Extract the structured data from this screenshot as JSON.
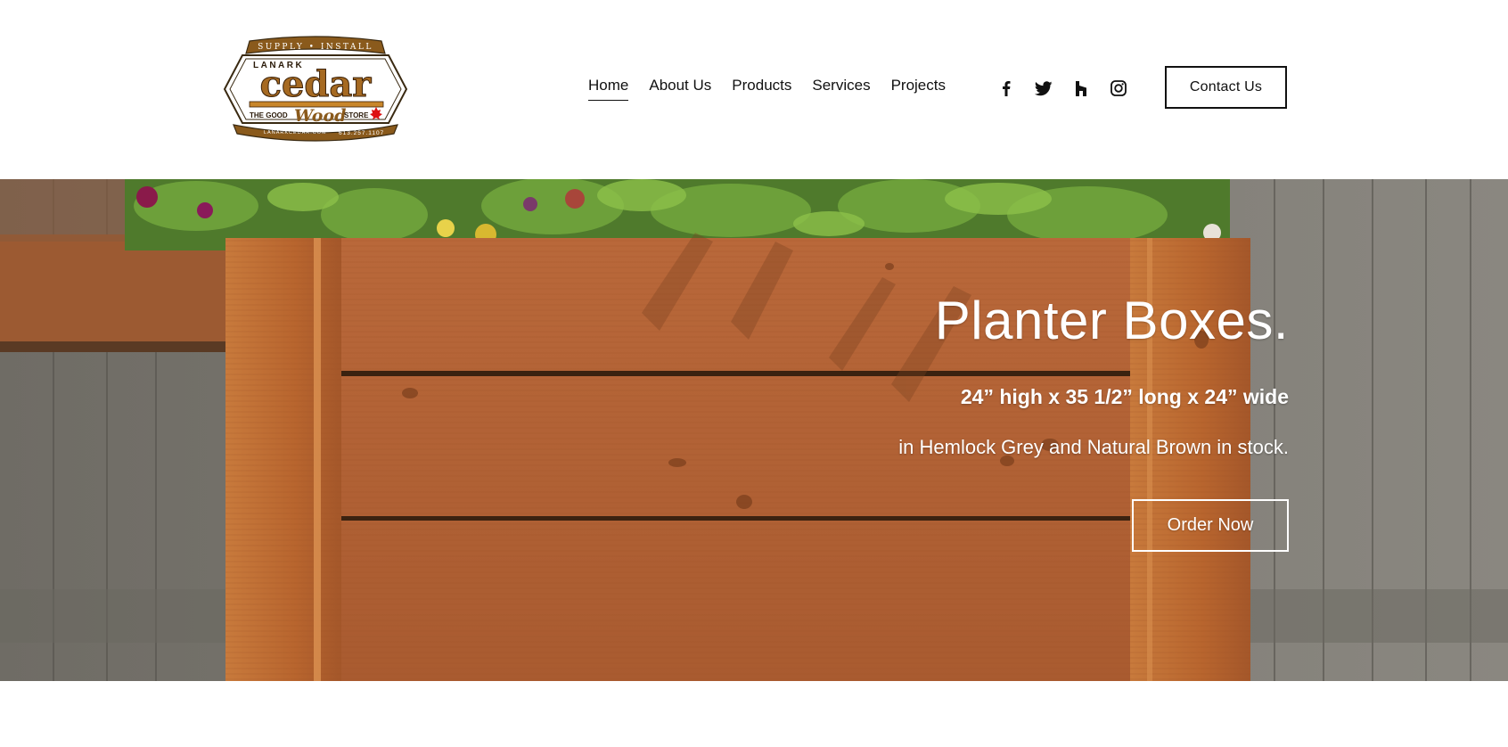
{
  "logo": {
    "top_text": "SUPPLY • INSTALL",
    "brand_small": "LANARK",
    "brand_main": "cedar",
    "tagline_left": "THE GOOD",
    "tagline_script": "Wood",
    "tagline_right": "STORE",
    "bottom_left": "LANARKCEDAR.COM",
    "bottom_right": "613.257.1107"
  },
  "nav": {
    "items": [
      {
        "label": "Home",
        "active": true
      },
      {
        "label": "About Us",
        "active": false
      },
      {
        "label": "Products",
        "active": false
      },
      {
        "label": "Services",
        "active": false
      },
      {
        "label": "Projects",
        "active": false
      }
    ]
  },
  "social": [
    "facebook-icon",
    "twitter-icon",
    "houzz-icon",
    "instagram-icon"
  ],
  "header": {
    "contact_label": "Contact Us"
  },
  "hero": {
    "title": "Planter Boxes.",
    "dimensions": "24” high x 35 1/2” long x 24” wide",
    "stock": "in Hemlock Grey and Natural Brown in stock.",
    "cta_label": "Order Now"
  },
  "colors": {
    "cedar": "#b86a3a",
    "cedar_dark": "#8a4a24",
    "fence": "#7a7a72",
    "logo_brown": "#7a4a14",
    "logo_gold": "#c8862a"
  }
}
